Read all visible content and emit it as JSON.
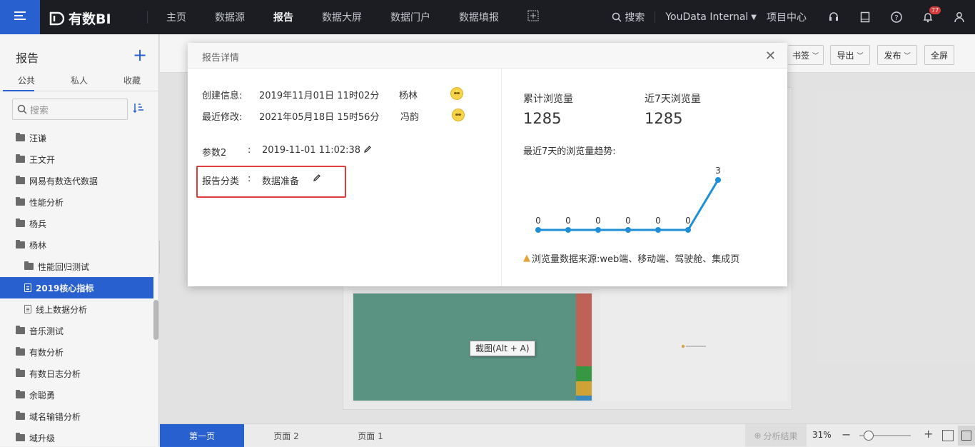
{
  "topbar": {
    "logo": "有数BI",
    "nav": [
      "主页",
      "数据源",
      "报告",
      "数据大屏",
      "数据门户",
      "数据填报"
    ],
    "search_label": "搜索",
    "workspace": "YouData Internal",
    "project_center": "项目中心",
    "notification_count": "77"
  },
  "sidebar": {
    "title": "报告",
    "tabs": [
      "公共",
      "私人",
      "收藏"
    ],
    "search_placeholder": "搜索",
    "items": [
      {
        "label": "汪谦",
        "type": "folder"
      },
      {
        "label": "王文开",
        "type": "folder"
      },
      {
        "label": "网易有数迭代数据",
        "type": "folder"
      },
      {
        "label": "性能分析",
        "type": "folder"
      },
      {
        "label": "杨兵",
        "type": "folder"
      },
      {
        "label": "杨林",
        "type": "folder"
      },
      {
        "label": "性能回归测试",
        "type": "folder",
        "sub": true
      },
      {
        "label": "2019核心指标",
        "type": "report",
        "sub": true,
        "active": true
      },
      {
        "label": "线上数据分析",
        "type": "report",
        "sub": true
      },
      {
        "label": "音乐测试",
        "type": "folder"
      },
      {
        "label": "有数分析",
        "type": "folder"
      },
      {
        "label": "有数日志分析",
        "type": "folder"
      },
      {
        "label": "余聪勇",
        "type": "folder"
      },
      {
        "label": "域名输错分析",
        "type": "folder"
      },
      {
        "label": "域升级",
        "type": "folder"
      }
    ]
  },
  "toolbar": {
    "bookmark": "书签",
    "export": "导出",
    "publish": "发布",
    "fullscreen": "全屏"
  },
  "canvas": {
    "tooltip": "截图(Alt + A)"
  },
  "bottom": {
    "pages": [
      "第一页",
      "页面 2",
      "页面 1"
    ],
    "analysis_result": "分析结果",
    "zoom": "31%"
  },
  "modal": {
    "title": "报告详情",
    "created_label": "创建信息:",
    "created_time": "2019年11月01日 11时02分",
    "created_by": "杨林",
    "modified_label": "最近修改:",
    "modified_time": "2021年05月18日 15时56分",
    "modified_by": "冯韵",
    "param_label": "参数2",
    "param_value": "2019-11-01 11:02:38",
    "category_label": "报告分类",
    "category_value": "数据准备",
    "colon": ":",
    "total_views_label": "累计浏览量",
    "total_views": "1285",
    "week_views_label": "近7天浏览量",
    "week_views": "1285",
    "trend_title": "最近7天的浏览量趋势:",
    "source_note": "浏览量数据来源:web端、移动端、驾驶舱、集成页"
  },
  "chart_data": {
    "type": "line",
    "x": [
      1,
      2,
      3,
      4,
      5,
      6,
      7
    ],
    "values": [
      0,
      0,
      0,
      0,
      0,
      0,
      3
    ],
    "ylim": [
      0,
      3
    ],
    "color": "#1e8fd6"
  }
}
